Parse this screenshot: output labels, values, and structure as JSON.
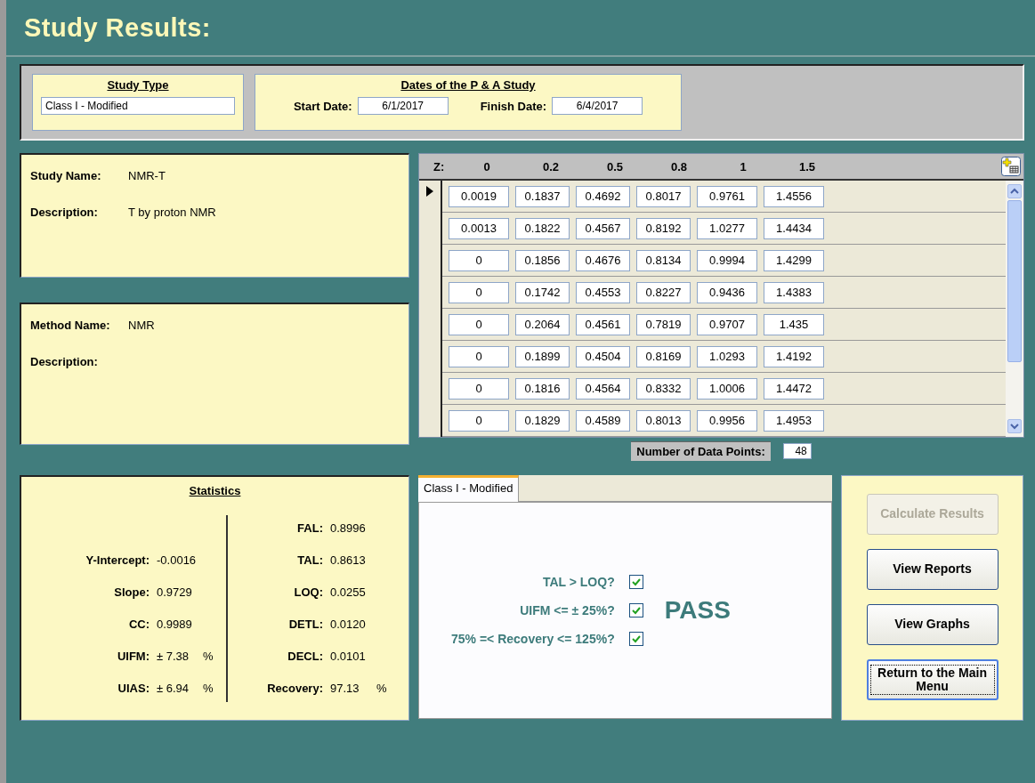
{
  "window": {
    "title": "Study Results:"
  },
  "study_type": {
    "heading": "Study Type",
    "value": "Class I - Modified"
  },
  "dates": {
    "heading": "Dates of the P & A Study",
    "start_label": "Start Date:",
    "start": "6/1/2017",
    "finish_label": "Finish Date:",
    "finish": "6/4/2017"
  },
  "study": {
    "name_label": "Study Name:",
    "name": "NMR-T",
    "description_label": "Description:",
    "description": "T by proton NMR"
  },
  "method": {
    "name_label": "Method Name:",
    "name": "NMR",
    "description_label": "Description:"
  },
  "grid": {
    "z_label": "Z:",
    "columns": [
      "0",
      "0.2",
      "0.5",
      "0.8",
      "1",
      "1.5"
    ],
    "rows": [
      {
        "current": true,
        "cells": [
          "0.0019",
          "0.1837",
          "0.4692",
          "0.8017",
          "0.9761",
          "1.4556"
        ]
      },
      {
        "current": false,
        "cells": [
          "0.0013",
          "0.1822",
          "0.4567",
          "0.8192",
          "1.0277",
          "1.4434"
        ]
      },
      {
        "current": false,
        "cells": [
          "0",
          "0.1856",
          "0.4676",
          "0.8134",
          "0.9994",
          "1.4299"
        ]
      },
      {
        "current": false,
        "cells": [
          "0",
          "0.1742",
          "0.4553",
          "0.8227",
          "0.9436",
          "1.4383"
        ]
      },
      {
        "current": false,
        "cells": [
          "0",
          "0.2064",
          "0.4561",
          "0.7819",
          "0.9707",
          "1.435"
        ]
      },
      {
        "current": false,
        "cells": [
          "0",
          "0.1899",
          "0.4504",
          "0.8169",
          "1.0293",
          "1.4192"
        ]
      },
      {
        "current": false,
        "cells": [
          "0",
          "0.1816",
          "0.4564",
          "0.8332",
          "1.0006",
          "1.4472"
        ]
      },
      {
        "current": false,
        "cells": [
          "0",
          "0.1829",
          "0.4589",
          "0.8013",
          "0.9956",
          "1.4953"
        ]
      }
    ]
  },
  "data_points": {
    "label": "Number of Data Points:",
    "value": "48"
  },
  "statistics": {
    "heading": "Statistics",
    "left": [
      {
        "label": "Y-Intercept:",
        "value": "-0.0016"
      },
      {
        "label": "Slope:",
        "value": "0.9729"
      },
      {
        "label": "CC:",
        "value": "0.9989"
      },
      {
        "label": "UIFM:",
        "value": "± 7.38",
        "unit": "%"
      },
      {
        "label": "UIAS:",
        "value": "± 6.94",
        "unit": "%"
      }
    ],
    "right": [
      {
        "label": "FAL:",
        "value": "0.8996"
      },
      {
        "label": "TAL:",
        "value": "0.8613"
      },
      {
        "label": "LOQ:",
        "value": "0.0255"
      },
      {
        "label": "DETL:",
        "value": "0.0120"
      },
      {
        "label": "DECL:",
        "value": "0.0101"
      },
      {
        "label": "Recovery:",
        "value": "97.13",
        "unit": "%"
      }
    ]
  },
  "criteria": {
    "tabs": [
      {
        "label": "Class I - Modified",
        "selected": true
      }
    ],
    "checks": [
      {
        "label": "TAL > LOQ?",
        "checked": true
      },
      {
        "label": "UIFM <= ± 25%?",
        "checked": true
      },
      {
        "label": "75% =< Recovery <= 125%?",
        "checked": true
      }
    ],
    "result": "PASS"
  },
  "buttons": [
    {
      "label": "Calculate Results",
      "disabled": true,
      "focused": false
    },
    {
      "label": "View Reports",
      "disabled": false,
      "focused": false
    },
    {
      "label": "View Graphs",
      "disabled": false,
      "focused": false
    },
    {
      "label": "Return to the Main Menu",
      "disabled": false,
      "focused": true
    }
  ]
}
